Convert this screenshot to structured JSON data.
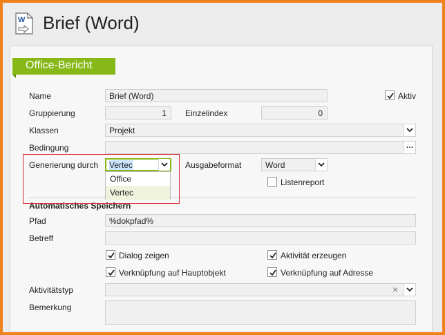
{
  "window": {
    "title": "Brief (Word)",
    "icon": "word-document-icon"
  },
  "section": {
    "title": "Office-Bericht"
  },
  "fields": {
    "name": {
      "label": "Name",
      "value": "Brief (Word)"
    },
    "aktiv": {
      "label": "Aktiv",
      "checked": true
    },
    "gruppierung": {
      "label": "Gruppierung",
      "value": "1"
    },
    "einzelindex": {
      "label": "Einzelindex",
      "value": "0"
    },
    "klassen": {
      "label": "Klassen",
      "value": "Projekt"
    },
    "bedingung": {
      "label": "Bedingung",
      "value": "",
      "button": "…"
    },
    "generierung": {
      "label": "Generierung durch",
      "value": "Vertec",
      "options": [
        "Office",
        "Vertec"
      ],
      "selected_option": "Vertec"
    },
    "ausgabeformat": {
      "label": "Ausgabeformat",
      "value": "Word"
    },
    "listenreport": {
      "label": "Listenreport",
      "checked": false
    }
  },
  "auto_save": {
    "header": "Automatisches Speichern",
    "pfad": {
      "label": "Pfad",
      "value": "%dokpfad%"
    },
    "betreff": {
      "label": "Betreff",
      "value": ""
    },
    "dialog_zeigen": {
      "label": "Dialog zeigen",
      "checked": true
    },
    "aktivitaet_erzeugen": {
      "label": "Aktivität erzeugen",
      "checked": true
    },
    "verkn_hauptobjekt": {
      "label": "Verknüpfung auf Hauptobjekt",
      "checked": true
    },
    "verkn_adresse": {
      "label": "Verknüpfung auf Adresse",
      "checked": true
    },
    "aktivitaetstyp": {
      "label": "Aktivitätstyp",
      "value": "",
      "clear": "×"
    },
    "bemerkung": {
      "label": "Bemerkung",
      "value": ""
    }
  },
  "colors": {
    "frame": "#f0821e",
    "section_head": "#86b817",
    "highlight_box": "#d9252b",
    "selected_text": "#3399ff"
  }
}
